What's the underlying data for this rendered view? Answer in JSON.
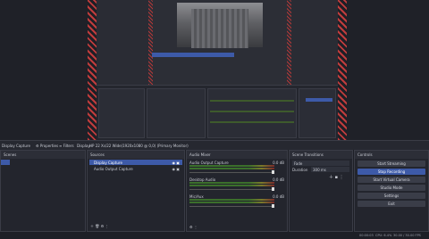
{
  "toolbar": {
    "source_name": "Display Capture",
    "properties": "Properties",
    "filters": "Filters",
    "display_label": "Display:",
    "display_value": "HP 22 Xs/22 Wide(1920x1080 @ 0,0) (Primary Monitor)"
  },
  "scenes": {
    "title": "Scenes"
  },
  "sources": {
    "title": "Sources",
    "items": [
      "Display Capture",
      "Audio Output Capture"
    ]
  },
  "mixer": {
    "title": "Audio Mixer",
    "channels": [
      {
        "name": "Audio Output Capture",
        "db": "0.0 dB"
      },
      {
        "name": "Desktop Audio",
        "db": "0.0 dB"
      },
      {
        "name": "Mic/Aux",
        "db": "0.0 dB"
      }
    ]
  },
  "transitions": {
    "title": "Scene Transitions",
    "type": "Fade",
    "duration_label": "Duration",
    "duration_value": "300 ms"
  },
  "controls": {
    "title": "Controls",
    "buttons": [
      "Start Streaming",
      "Stop Recording",
      "Start Virtual Camera",
      "Studio Mode",
      "Settings",
      "Exit"
    ],
    "active_index": 1
  },
  "status": {
    "rec_time": "00:00:03",
    "cpu": "CPU: 6.4%",
    "fps": "30.00 / 30.00 FPS"
  },
  "colors": {
    "accent": "#3d5aa8",
    "hatch": "#c13c3c"
  }
}
